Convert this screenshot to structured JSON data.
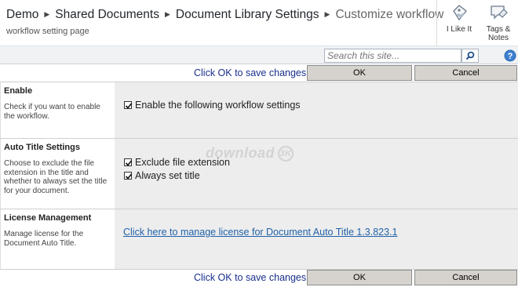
{
  "header": {
    "breadcrumb": [
      "Demo",
      "Shared Documents",
      "Document Library Settings",
      "Customize workflow"
    ],
    "subtitle": "workflow setting page"
  },
  "social": {
    "like_label": "I Like It",
    "tags_label_1": "Tags &",
    "tags_label_2": "Notes"
  },
  "search": {
    "placeholder": "Search this site..."
  },
  "icons": {
    "search": "search-icon",
    "help": "help-icon",
    "like": "like-icon",
    "tags": "tags-notes-icon",
    "checkbox": "checkbox-checked-icon"
  },
  "toolbar": {
    "message": "Click OK to save changes",
    "ok_label": "OK",
    "cancel_label": "Cancel"
  },
  "sections": {
    "enable": {
      "title": "Enable",
      "description": "Check if you want to enable the workflow.",
      "option": "Enable the following workflow settings",
      "option_checked": true
    },
    "auto_title": {
      "title": "Auto Title Settings",
      "description": "Choose to exclude the file extension in the title and whether to always set the title for your document.",
      "options": [
        {
          "label": "Exclude file extension",
          "checked": true
        },
        {
          "label": "Always set title",
          "checked": true
        }
      ]
    },
    "license": {
      "title": "License Management",
      "description": "Manage license for the Document Auto Title.",
      "link": "Click here to manage license for Document Auto Title 1.3.823.1"
    }
  },
  "watermark": {
    "text": "download",
    "badge": "3K"
  },
  "colors": {
    "link": "#1f61a9",
    "message": "#1a2f8c",
    "button_bg": "#d6d3ce",
    "section_bg": "#ededed"
  }
}
